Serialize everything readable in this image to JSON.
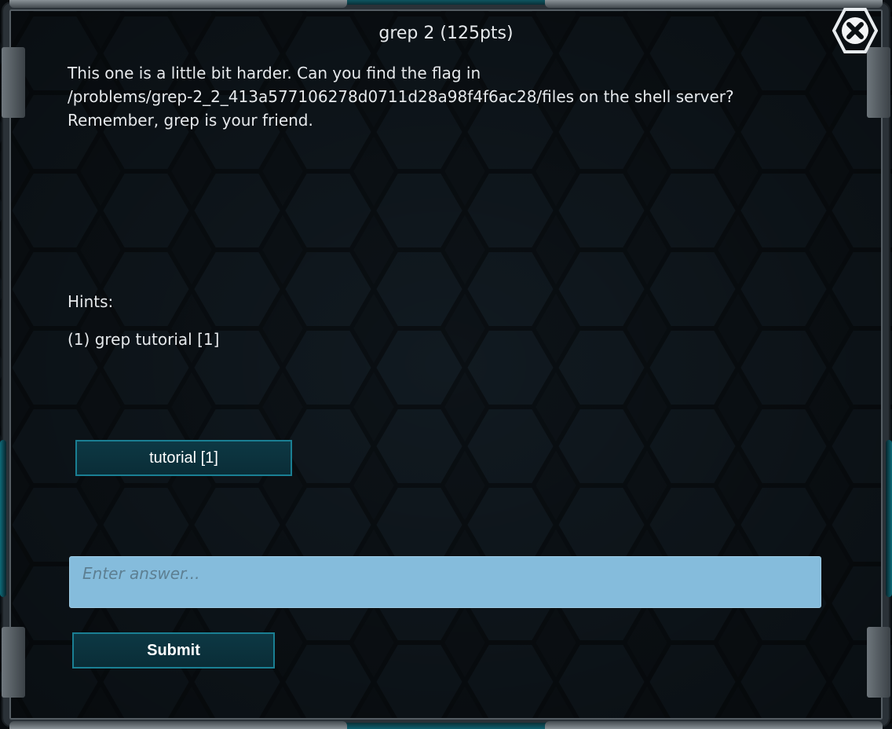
{
  "dialog": {
    "title": "grep 2 (125pts)",
    "description_lines": [
      "This one is a little bit harder. Can you find the flag in",
      "/problems/grep-2_2_413a577106278d0711d28a98f4f6ac28/files on the shell server?",
      "Remember, grep is your friend."
    ],
    "close_icon": "close-icon"
  },
  "hints": {
    "label": "Hints:",
    "items": [
      "(1) grep tutorial [1]"
    ],
    "button_label": "tutorial [1]"
  },
  "answer": {
    "placeholder": "Enter answer...",
    "value": ""
  },
  "submit": {
    "label": "Submit"
  },
  "colors": {
    "background": "#0c1116",
    "accent": "#1a7f93",
    "input_bg": "#85bcdc",
    "text": "#e6e9ec"
  }
}
